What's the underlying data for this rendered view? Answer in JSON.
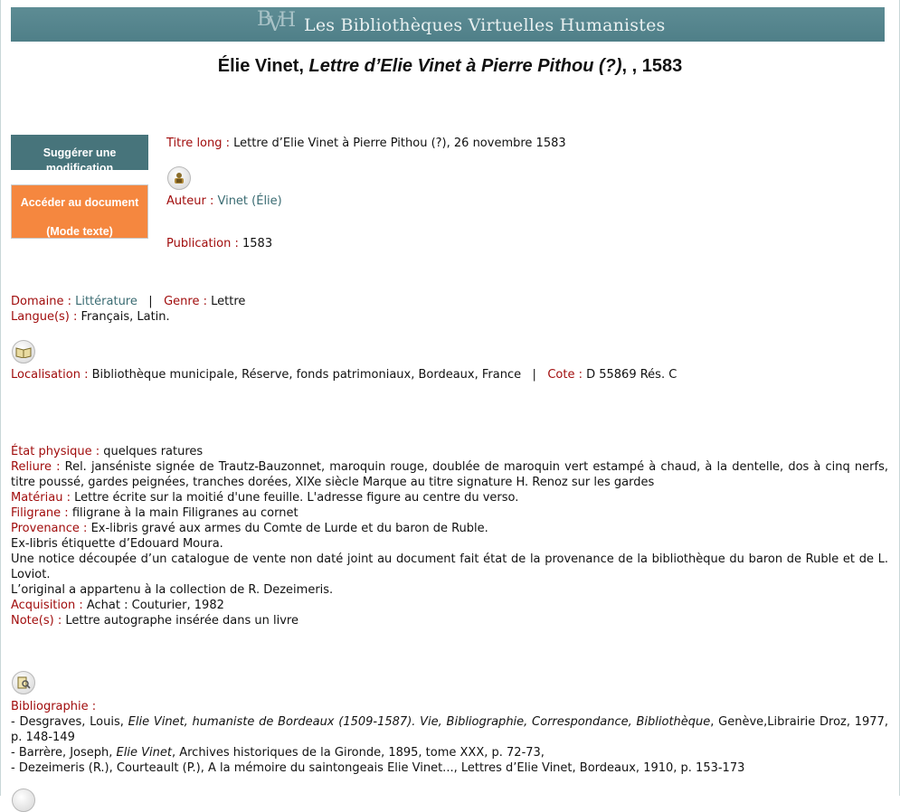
{
  "banner": {
    "logo_text": "BVH",
    "title": "Les Bibliothèques Virtuelles Humanistes"
  },
  "title": {
    "author": "Élie Vinet",
    "work": "Lettre d’Elie Vinet à Pierre Pithou (?)",
    "rest": ", , 1583"
  },
  "buttons": {
    "suggest": "Suggérer une modification",
    "access_line1": "Accéder au document",
    "access_line2": "(Mode texte)"
  },
  "record": {
    "titre_long_label": "Titre long :",
    "titre_long": "Lettre d’Elie Vinet à Pierre Pithou (?), 26 novembre 1583",
    "auteur_label": "Auteur :",
    "auteur": "Vinet (Élie)",
    "publication_label": "Publication :",
    "publication": "1583",
    "domaine_label": "Domaine :",
    "domaine": "Littérature",
    "genre_label": "Genre :",
    "genre": "Lettre",
    "langues_label": "Langue(s) :",
    "langues": "Français, Latin.",
    "localisation_label": "Localisation :",
    "localisation": "Bibliothèque municipale, Réserve, fonds patrimoniaux, Bordeaux, France",
    "cote_label": "Cote :",
    "cote": "D 55869 Rés. C",
    "etat_label": "État physique :",
    "etat": "quelques ratures",
    "reliure_label": "Reliure :",
    "reliure": "Rel. janséniste signée de Trautz-Bauzonnet, maroquin rouge, doublée de maroquin vert estampé à chaud, à la dentelle, dos à cinq nerfs, titre poussé, gardes peignées, tranches dorées, XIXe siècle Marque au titre signature H. Renoz sur les gardes",
    "materiau_label": "Matériau :",
    "materiau": "Lettre écrite sur la moitié d'une feuille. L'adresse figure au centre du verso.",
    "filigrane_label": "Filigrane :",
    "filigrane": "filigrane à la main Filigranes au cornet",
    "provenance_label": "Provenance :",
    "provenance_1": "Ex-libris gravé aux armes du Comte de Lurde et du baron de Ruble.",
    "provenance_2": "Ex-libris étiquette d’Edouard Moura.",
    "provenance_3": "Une notice découpée d’un catalogue de vente non daté joint au document fait état de la provenance de la bibliothèque du baron de Ruble et de L. Loviot.",
    "provenance_4": "L’original a appartenu à la collection de R. Dezeimeris.",
    "acquisition_label": "Acquisition :",
    "acquisition": "Achat : Couturier, 1982",
    "notes_label": "Note(s) :",
    "notes": "Lettre autographe insérée dans un livre"
  },
  "bibliographie": {
    "label": "Bibliographie :",
    "items": [
      {
        "pre": "- Desgraves, Louis, ",
        "it": "Elie Vinet, humaniste de Bordeaux (1509-1587). Vie, Bibliographie, Correspondance, Bibliothèque",
        "post": ", Genève,Librairie Droz, 1977, p. 148-149"
      },
      {
        "pre": "- Barrère, Joseph, ",
        "it": "Elie Vinet",
        "post": ", Archives historiques de la Gironde, 1895, tome XXX, p. 72-73,"
      },
      {
        "pre": "- Dezeimeris (R.), Courteault (P.), A la mémoire du saintongeais Elie Vinet..., Lettres d’Elie Vinet, Bordeaux, 1910, p. 153-173",
        "it": "",
        "post": ""
      }
    ]
  },
  "icons": [
    "author-icon",
    "book-icon",
    "search-book-icon"
  ]
}
